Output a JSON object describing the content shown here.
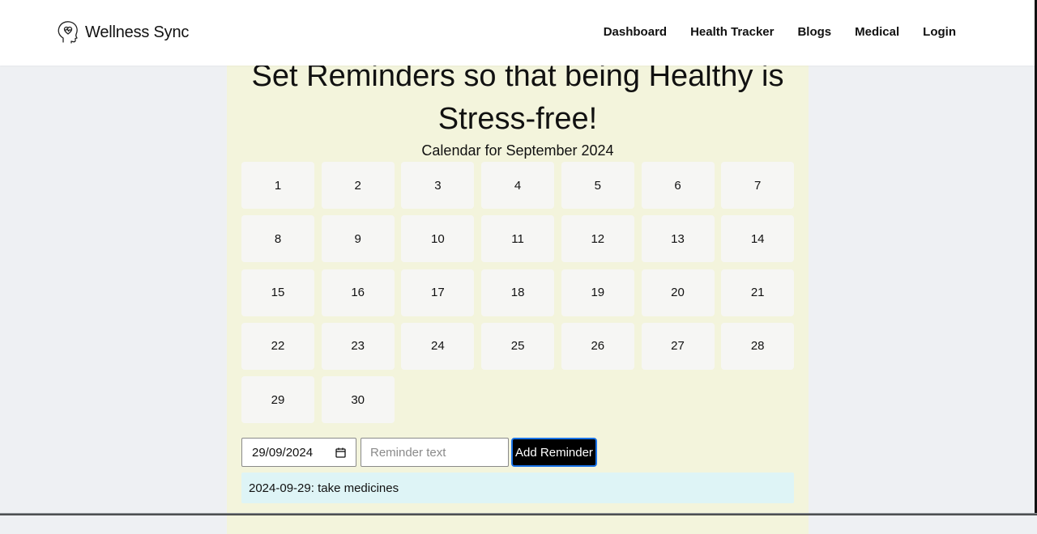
{
  "brand": {
    "name": "Wellness Sync",
    "logo_icon": "head-heart-icon"
  },
  "nav": {
    "links": [
      {
        "label": "Dashboard"
      },
      {
        "label": "Health Tracker"
      },
      {
        "label": "Blogs"
      },
      {
        "label": "Medical"
      },
      {
        "label": "Login"
      }
    ]
  },
  "main": {
    "heading_line1": "Set Reminders so that being Healthy is",
    "heading_line2": "Stress-free!",
    "calendar_title": "Calendar for September 2024",
    "days": [
      "1",
      "2",
      "3",
      "4",
      "5",
      "6",
      "7",
      "8",
      "9",
      "10",
      "11",
      "12",
      "13",
      "14",
      "15",
      "16",
      "17",
      "18",
      "19",
      "20",
      "21",
      "22",
      "23",
      "24",
      "25",
      "26",
      "27",
      "28",
      "29",
      "30"
    ]
  },
  "form": {
    "date_value": "29/09/2024",
    "reminder_placeholder": "Reminder text",
    "add_button_label": "Add Reminder"
  },
  "reminders": [
    {
      "text": "2024-09-29: take medicines"
    }
  ],
  "colors": {
    "page_bg": "#eef0f3",
    "panel_bg": "#f3f4dc",
    "day_bg": "#f6f6f4",
    "reminder_bg": "#def4f6",
    "button_bg": "#000000",
    "button_border": "#1a73e8"
  }
}
